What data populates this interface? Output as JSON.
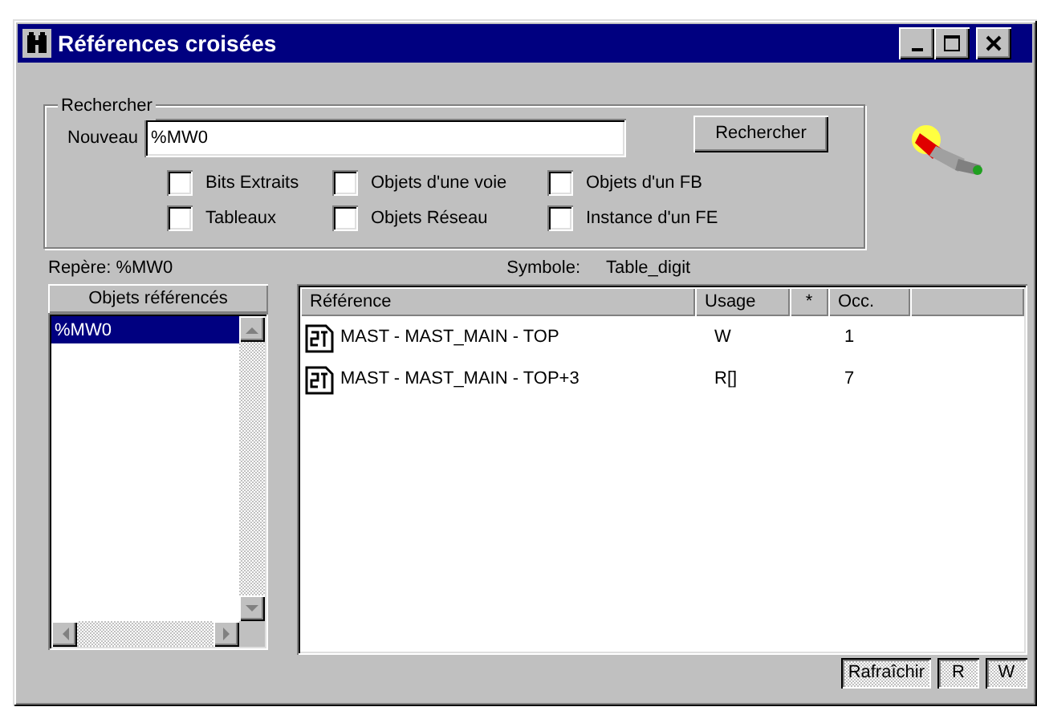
{
  "window": {
    "title": "Références croisées"
  },
  "search": {
    "group_label": "Rechercher",
    "field_label": "Nouveau",
    "value": "%MW0",
    "button": "Rechercher"
  },
  "filters": [
    {
      "label": "Bits Extraits",
      "checked": false
    },
    {
      "label": "Objets d'une voie",
      "checked": false
    },
    {
      "label": "Objets d'un FB",
      "checked": false
    },
    {
      "label": "Tableaux",
      "checked": false
    },
    {
      "label": "Objets Réseau",
      "checked": false
    },
    {
      "label": "Instance d'un FE",
      "checked": false
    }
  ],
  "info": {
    "marker": "Repère: %MW0",
    "symbol_label": "Symbole:",
    "symbol_value": "Table_digit"
  },
  "objects_panel": {
    "title": "Objets référencés",
    "items": [
      {
        "label": "%MW0",
        "selected": true
      }
    ]
  },
  "table": {
    "columns": [
      "Référence",
      "Usage",
      "*",
      "Occ."
    ],
    "rows": [
      {
        "reference": "MAST - MAST_MAIN - TOP",
        "usage": "W",
        "occ": "1"
      },
      {
        "reference": "MAST - MAST_MAIN - TOP+3",
        "usage": "R[]",
        "occ": "7"
      }
    ]
  },
  "buttons": [
    {
      "label": "Rafraîchir",
      "pressed": true
    },
    {
      "label": "R",
      "pressed": true
    },
    {
      "label": "W",
      "pressed": true
    }
  ]
}
